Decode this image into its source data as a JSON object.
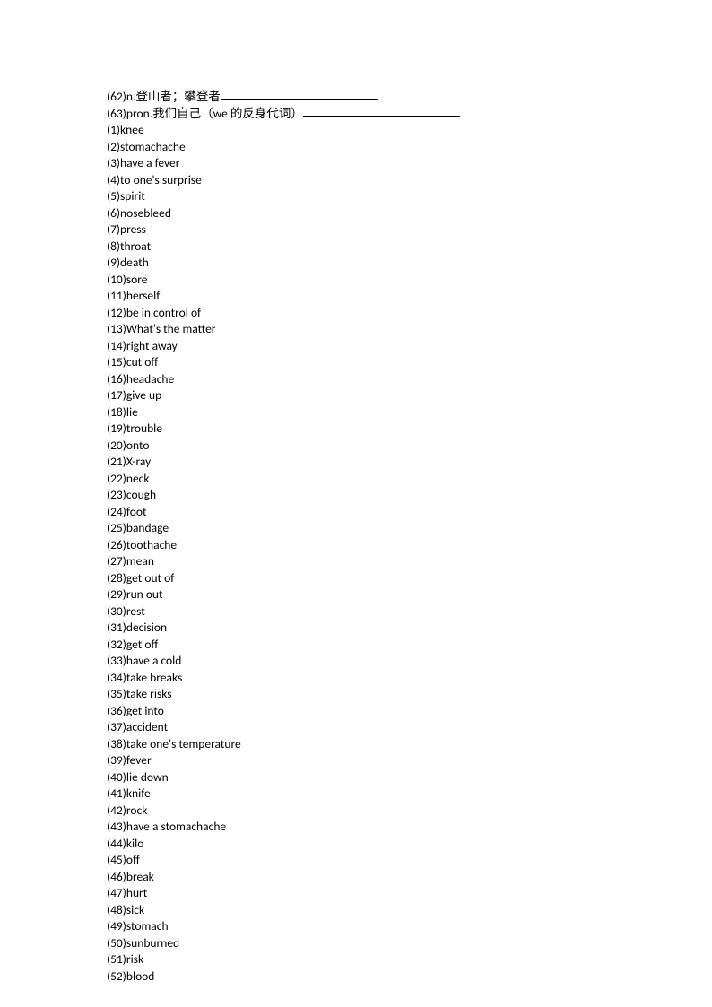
{
  "fill_in_lines": [
    {
      "num": "62",
      "text": "n.登山者；攀登者",
      "blank_width": 175
    },
    {
      "num": "63",
      "text": "pron.我们自己（we 的反身代词）",
      "blank_width": 175
    }
  ],
  "items": [
    {
      "num": "1",
      "text": "knee"
    },
    {
      "num": "2",
      "text": "stomachache"
    },
    {
      "num": "3",
      "text": "have a fever"
    },
    {
      "num": "4",
      "text": "to one's surprise"
    },
    {
      "num": "5",
      "text": "spirit"
    },
    {
      "num": "6",
      "text": "nosebleed"
    },
    {
      "num": "7",
      "text": "press"
    },
    {
      "num": "8",
      "text": "throat"
    },
    {
      "num": "9",
      "text": "death"
    },
    {
      "num": "10",
      "text": "sore"
    },
    {
      "num": "11",
      "text": "herself"
    },
    {
      "num": "12",
      "text": "be in control of"
    },
    {
      "num": "13",
      "text": "What's the matter"
    },
    {
      "num": "14",
      "text": "right away"
    },
    {
      "num": "15",
      "text": "cut off"
    },
    {
      "num": "16",
      "text": "headache"
    },
    {
      "num": "17",
      "text": "give up"
    },
    {
      "num": "18",
      "text": "lie"
    },
    {
      "num": "19",
      "text": "trouble"
    },
    {
      "num": "20",
      "text": "onto"
    },
    {
      "num": "21",
      "text": "X-ray"
    },
    {
      "num": "22",
      "text": "neck"
    },
    {
      "num": "23",
      "text": "cough"
    },
    {
      "num": "24",
      "text": "foot"
    },
    {
      "num": "25",
      "text": "bandage"
    },
    {
      "num": "26",
      "text": "toothache"
    },
    {
      "num": "27",
      "text": "mean"
    },
    {
      "num": "28",
      "text": "get out of"
    },
    {
      "num": "29",
      "text": "run out"
    },
    {
      "num": "30",
      "text": "rest"
    },
    {
      "num": "31",
      "text": "decision"
    },
    {
      "num": "32",
      "text": "get off"
    },
    {
      "num": "33",
      "text": "have a cold"
    },
    {
      "num": "34",
      "text": "take breaks"
    },
    {
      "num": "35",
      "text": "take risks"
    },
    {
      "num": "36",
      "text": "get into"
    },
    {
      "num": "37",
      "text": "accident"
    },
    {
      "num": "38",
      "text": "take one's temperature"
    },
    {
      "num": "39",
      "text": "fever"
    },
    {
      "num": "40",
      "text": "lie down"
    },
    {
      "num": "41",
      "text": "knife"
    },
    {
      "num": "42",
      "text": "rock"
    },
    {
      "num": "43",
      "text": "have a stomachache"
    },
    {
      "num": "44",
      "text": "kilo"
    },
    {
      "num": "45",
      "text": "off"
    },
    {
      "num": "46",
      "text": "break"
    },
    {
      "num": "47",
      "text": "hurt"
    },
    {
      "num": "48",
      "text": "sick"
    },
    {
      "num": "49",
      "text": "stomach"
    },
    {
      "num": "50",
      "text": "sunburned"
    },
    {
      "num": "51",
      "text": "risk"
    },
    {
      "num": "52",
      "text": "blood"
    }
  ]
}
